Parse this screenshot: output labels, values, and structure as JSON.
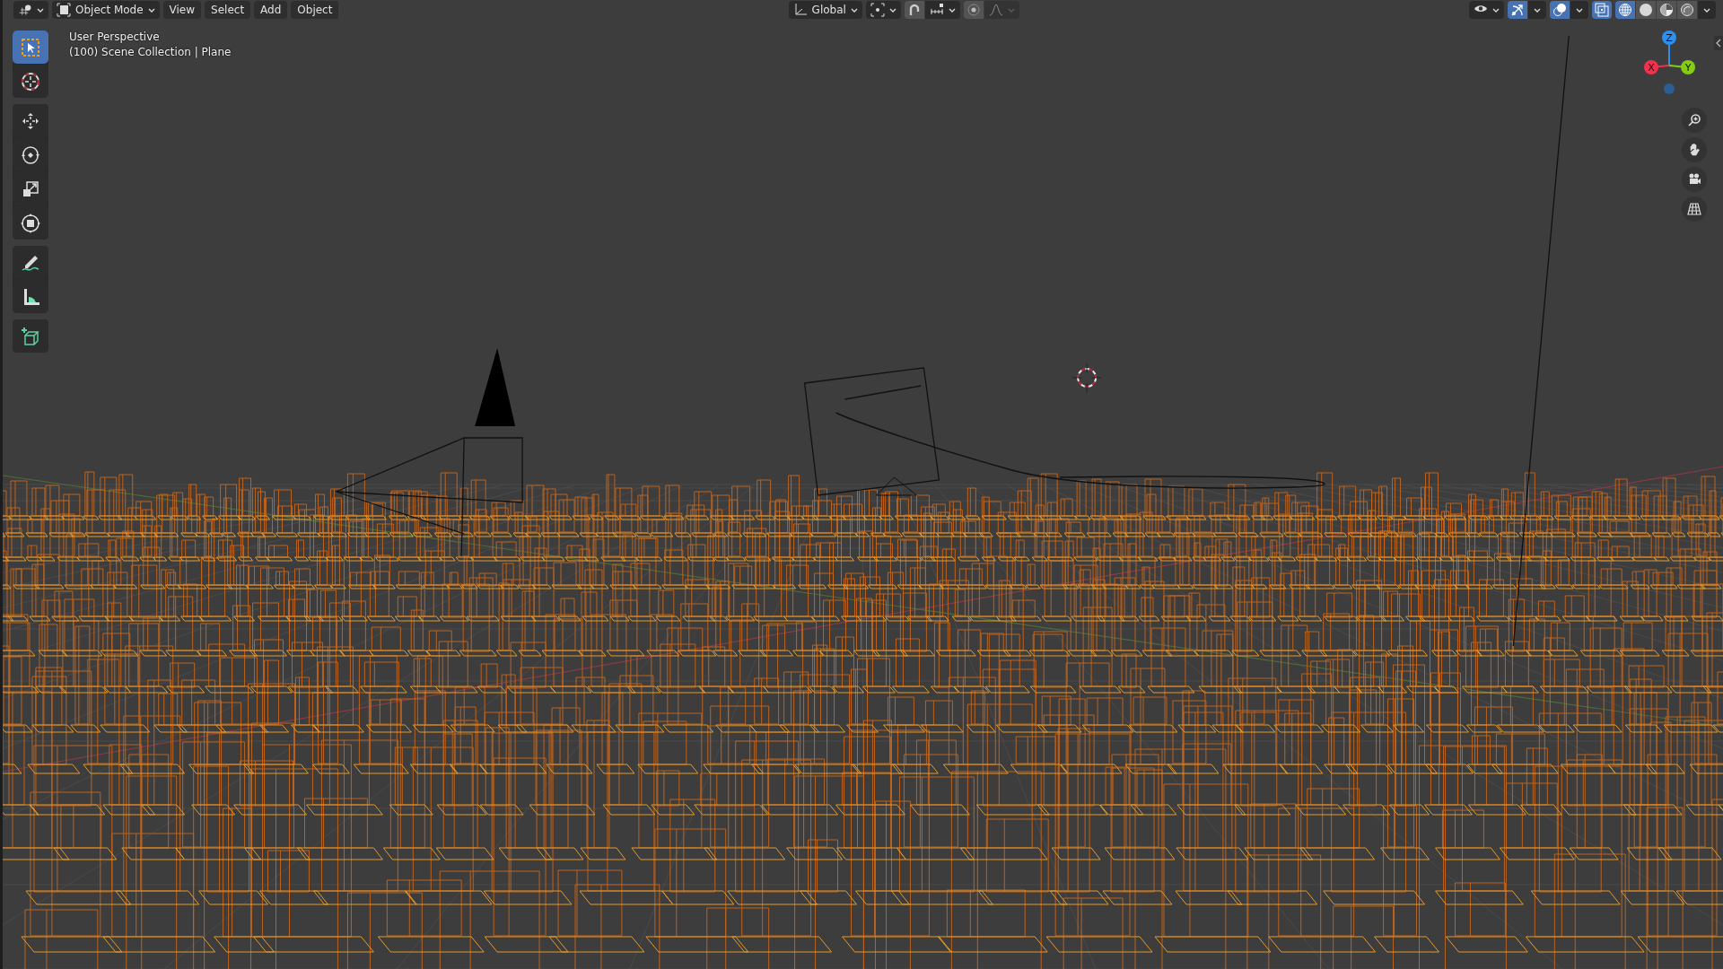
{
  "header": {
    "mode": {
      "label": "Object Mode"
    },
    "menus": [
      {
        "label": "View"
      },
      {
        "label": "Select"
      },
      {
        "label": "Add"
      },
      {
        "label": "Object"
      }
    ],
    "orientation": {
      "label": "Global"
    },
    "snap": {
      "on": false
    },
    "proportional_editing": {
      "on": false
    },
    "gizmos": {
      "on": true
    },
    "overlays": {
      "on": true
    },
    "xray": {
      "on": true
    },
    "shading": [
      {
        "kind": "wireframe",
        "selected": true
      },
      {
        "kind": "solid",
        "selected": false
      },
      {
        "kind": "material",
        "selected": false
      },
      {
        "kind": "rendered",
        "selected": false
      }
    ]
  },
  "viewport": {
    "info": [
      "User Perspective",
      "(100) Scene Collection | Plane"
    ]
  },
  "tool_groups": [
    {
      "tools": [
        {
          "kind": "select",
          "selected": true
        },
        {
          "kind": "cursor",
          "selected": false
        }
      ]
    },
    {
      "tools": [
        {
          "kind": "move",
          "selected": false
        },
        {
          "kind": "rotate",
          "selected": false
        },
        {
          "kind": "scale",
          "selected": false
        },
        {
          "kind": "transform",
          "selected": false
        }
      ]
    },
    {
      "tools": [
        {
          "kind": "annotate",
          "selected": false
        },
        {
          "kind": "measure",
          "selected": false
        }
      ]
    },
    {
      "tools": [
        {
          "kind": "add_cube",
          "selected": false
        }
      ]
    }
  ],
  "gizmo": {
    "axes": [
      {
        "label": "Z",
        "color": "#2f8ff0"
      },
      {
        "label": "X",
        "color": "#f5304d"
      },
      {
        "label": "Y",
        "color": "#84cc16"
      }
    ]
  },
  "nav_tools": [
    {
      "kind": "zoom"
    },
    {
      "kind": "pan"
    },
    {
      "kind": "camera"
    },
    {
      "kind": "ortho"
    }
  ]
}
